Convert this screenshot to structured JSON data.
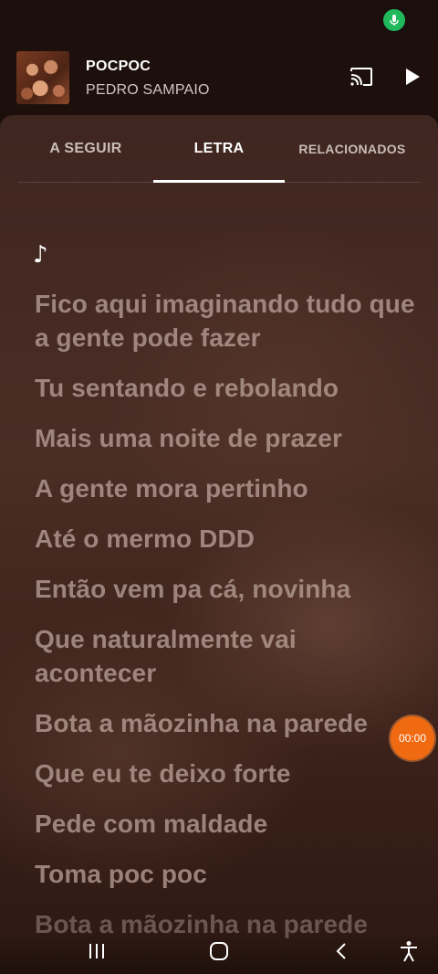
{
  "status_bar": {
    "mic_icon": "microphone-icon",
    "mic_color": "#1fb85a"
  },
  "player": {
    "title": "POCPOC",
    "artist": "PEDRO SAMPAIO",
    "cast_icon": "cast-icon",
    "play_icon": "play-icon"
  },
  "tabs": [
    {
      "label": "A SEGUIR",
      "active": false
    },
    {
      "label": "LETRA",
      "active": true
    },
    {
      "label": "RELACIONADOS",
      "active": false
    }
  ],
  "lyrics": {
    "note": "♪",
    "lines": [
      "Fico aqui imaginando tudo que a gente pode fazer",
      "Tu sentando e rebolando",
      "Mais uma noite de prazer",
      "A gente mora pertinho",
      "Até o mermo DDD",
      "Então vem pa cá, novinha",
      "Que naturalmente vai acontecer",
      "Bota a mãozinha na parede",
      "Que eu te deixo forte",
      "Pede com maldade",
      "Toma poc poc",
      "Bota a mãozinha na parede"
    ]
  },
  "timer": {
    "label": "00:00",
    "color": "#f06a12"
  },
  "nav": {
    "recents_icon": "recents-icon",
    "home_icon": "home-icon",
    "back_icon": "back-icon",
    "accessibility_icon": "accessibility-icon"
  }
}
